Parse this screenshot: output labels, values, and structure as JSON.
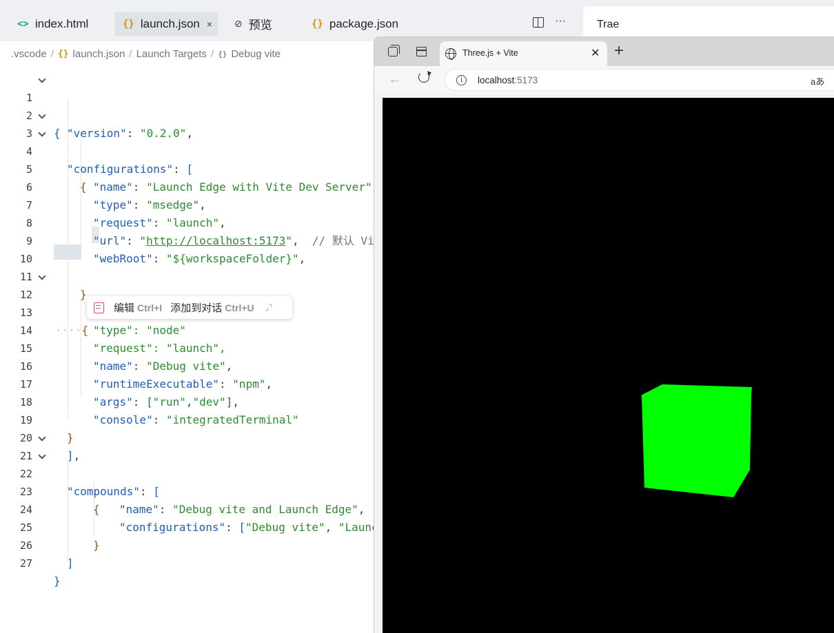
{
  "editor": {
    "tabs": [
      {
        "label": "index.html",
        "icon": "html-file-icon",
        "glyph": "<>"
      },
      {
        "label": "launch.json",
        "icon": "json-file-icon",
        "glyph": "{}"
      },
      {
        "label": "预览",
        "icon": "link-icon",
        "glyph": "⊘"
      },
      {
        "label": "package.json",
        "icon": "json-file-icon",
        "glyph": "{}"
      }
    ],
    "active_tab": "launch.json",
    "tab_close": "×",
    "more_glyph": "···",
    "breadcrumb": [
      ".vscode",
      "launch.json",
      "Launch Targets",
      "Debug vite"
    ],
    "breadcrumb_sep": "/",
    "breadcrumb_json_glyph": "{}",
    "breadcrumb_obj_glyph": "{}",
    "line_numbers": [
      "1",
      "2",
      "3",
      "4",
      "5",
      "6",
      "7",
      "8",
      "9",
      "10",
      "11",
      "12",
      "13",
      "14",
      "15",
      "16",
      "17",
      "18",
      "19",
      "20",
      "21",
      "22",
      "23",
      "24",
      "25",
      "26",
      "27"
    ]
  },
  "code": {
    "version_key": "\"version\"",
    "version_val": "\"0.2.0\"",
    "configurations_key": "\"configurations\"",
    "name_key": "\"name\"",
    "name1_val": "\"Launch Edge with Vite Dev Server\"",
    "type_key": "\"type\"",
    "type1_val": "\"msedge\"",
    "request_key": "\"request\"",
    "request1_val": "\"launch\"",
    "url_key": "\"url\"",
    "url_q1": "\"",
    "url_link": "http://localhost:5173",
    "url_q2": "\"",
    "url_comment": "// 默认 Vite",
    "webroot_key": "\"webRoot\"",
    "webroot_val": "\"${workspaceFolder}\"",
    "type2_partial": "\"type\": \"node\"",
    "request2_partial": "\"request\": \"launch\",",
    "name2_val": "\"Debug vite\"",
    "runtime_key": "\"runtimeExecutable\"",
    "runtime_val": "\"npm\"",
    "args_key": "\"args\"",
    "args_v1": "\"run\"",
    "args_v2": "\"dev\"",
    "console_key": "\"console\"",
    "console_val": "\"integratedTerminal\"",
    "compounds_key": "\"compounds\"",
    "name3_val": "\"Debug vite and Launch Edge\"",
    "configurations2_key": "\"configurations\"",
    "conf_v1": "\"Debug vite\"",
    "conf_v2": "\"Launch"
  },
  "popup": {
    "edit_label": "编辑",
    "edit_shortcut": "Ctrl+I",
    "add_label": "添加到对话",
    "add_shortcut": "Ctrl+U",
    "collapse_glyph": "⌟⌝"
  },
  "trae": {
    "title": "Trae"
  },
  "browser": {
    "tab_title": "Three.js + Vite",
    "tab_close": "✕",
    "new_tab": "+",
    "back": "←",
    "url_host": "localhost",
    "url_port": ":5173",
    "info_glyph": "i",
    "read_aloud": "aあ",
    "cube_color": "#00ff00",
    "viewport_color": "#000000"
  }
}
